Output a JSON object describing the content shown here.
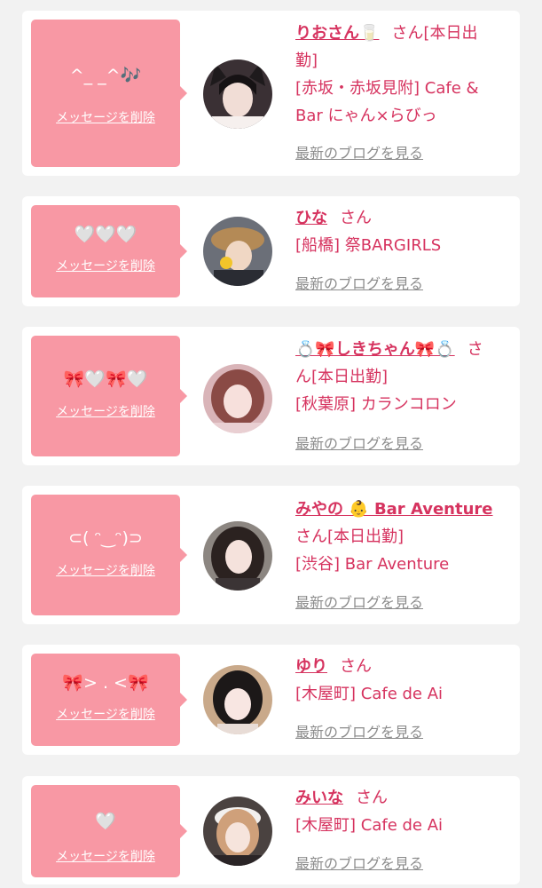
{
  "colors": {
    "accent": "#d6335f",
    "bubble": "#f898a4",
    "background": "#f2f2f2",
    "card": "#ffffff",
    "link_gray": "#8c8c8c"
  },
  "cards": [
    {
      "message": "^_ _^🎶",
      "delete_label": "メッセージを削除",
      "name": "りおさん🥛",
      "san": "さん[本日出",
      "line2": "勤]",
      "shop": "[赤坂・赤坂見附] Cafe &",
      "shop2": "Bar にゃん×らびっ",
      "blog_label": "最新のブログを見る",
      "avatar_icon": "avatar-photo"
    },
    {
      "message": "🤍🤍🤍",
      "delete_label": "メッセージを削除",
      "name": "ひな",
      "san": "さん",
      "shop": "[船橋] 祭BARGIRLS",
      "blog_label": "最新のブログを見る",
      "avatar_icon": "avatar-photo"
    },
    {
      "message": "🎀🤍🎀🤍",
      "delete_label": "メッセージを削除",
      "name": "💍🎀しきちゃん🎀💍",
      "san": "さ",
      "line2": "ん[本日出勤]",
      "shop": "[秋葉原] カランコロン",
      "blog_label": "最新のブログを見る",
      "avatar_icon": "avatar-photo"
    },
    {
      "message": "⊂( ᵔ‿ᵔ)⊃",
      "delete_label": "メッセージを削除",
      "name": "みやの 👶 Bar Aventure",
      "san": "さん[本日出勤]",
      "shop": "[渋谷] Bar Aventure",
      "blog_label": "最新のブログを見る",
      "avatar_icon": "avatar-photo"
    },
    {
      "message": "🎀> . <🎀",
      "delete_label": "メッセージを削除",
      "name": "ゆり",
      "san": "さん",
      "shop": "[木屋町] Cafe de Ai",
      "blog_label": "最新のブログを見る",
      "avatar_icon": "avatar-photo"
    },
    {
      "message": "🤍",
      "delete_label": "メッセージを削除",
      "name": "みいな",
      "san": "さん",
      "shop": "[木屋町] Cafe de Ai",
      "blog_label": "最新のブログを見る",
      "avatar_icon": "avatar-photo"
    }
  ]
}
